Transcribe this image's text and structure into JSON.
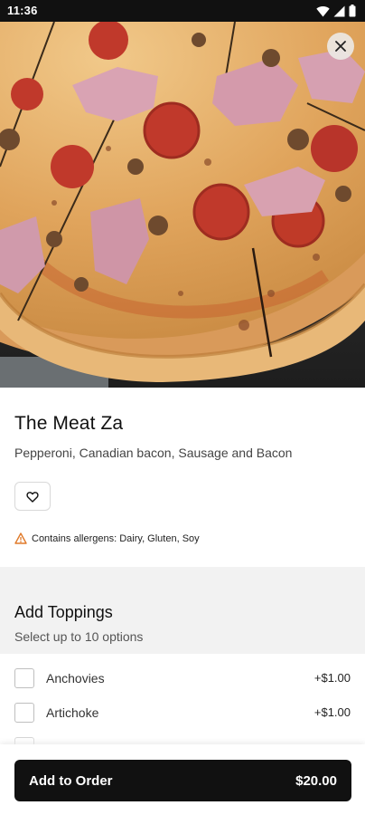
{
  "status_bar": {
    "time": "11:36",
    "icons": [
      "wifi-icon",
      "signal-icon",
      "battery-icon"
    ]
  },
  "hero": {
    "image": "pizza-photo",
    "close_icon": "close-icon"
  },
  "product": {
    "name": "The Meat Za",
    "description": "Pepperoni, Canadian bacon, Sausage and Bacon",
    "favorite_icon": "heart-icon",
    "allergen_icon": "warning-icon",
    "allergen_text": "Contains allergens: Dairy, Gluten, Soy"
  },
  "toppings_section": {
    "title": "Add Toppings",
    "subtitle": "Select up to 10 options",
    "items": [
      {
        "name": "Anchovies",
        "price": "+$1.00"
      },
      {
        "name": "Artichoke",
        "price": "+$1.00"
      },
      {
        "name": "",
        "price": ""
      }
    ]
  },
  "order_button": {
    "label": "Add to Order",
    "price": "$20.00"
  },
  "colors": {
    "button_bg": "#111111",
    "allergen_warning": "#e07a2a",
    "section_bg": "#f2f2f2"
  }
}
